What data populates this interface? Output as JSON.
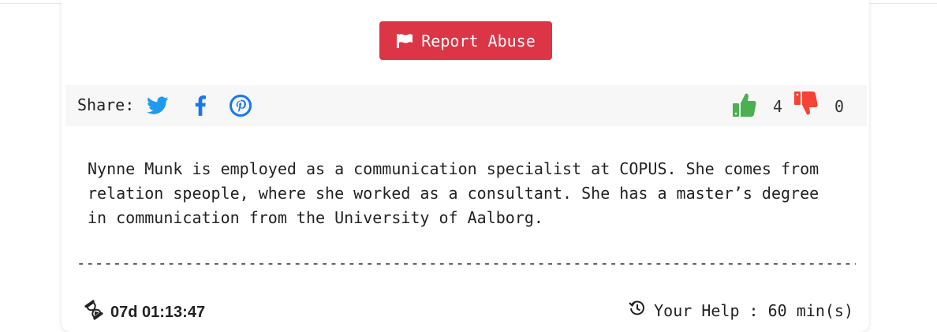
{
  "report": {
    "label": "Report Abuse",
    "icon": "flag-icon",
    "color": "#dc3545"
  },
  "share": {
    "label": "Share:",
    "icons": [
      "twitter-icon",
      "facebook-icon",
      "pinterest-icon"
    ],
    "brand_color": "#1d9bf0"
  },
  "votes": {
    "up_count": "4",
    "down_count": "0",
    "up_color": "#4caf50",
    "down_color": "#f44336"
  },
  "bio": {
    "text": "Nynne Munk is employed as a communication specialist at COPUS. She comes from relation speople, where she worked as a consultant. She has a master’s degree in communication from the University of Aalborg."
  },
  "divider": "--------------------------------------------------------------------------------------------",
  "footer": {
    "countdown": "07d 01:13:47",
    "help_label": "Your Help",
    "help_separator": " : ",
    "help_value": "60 min(s)"
  }
}
